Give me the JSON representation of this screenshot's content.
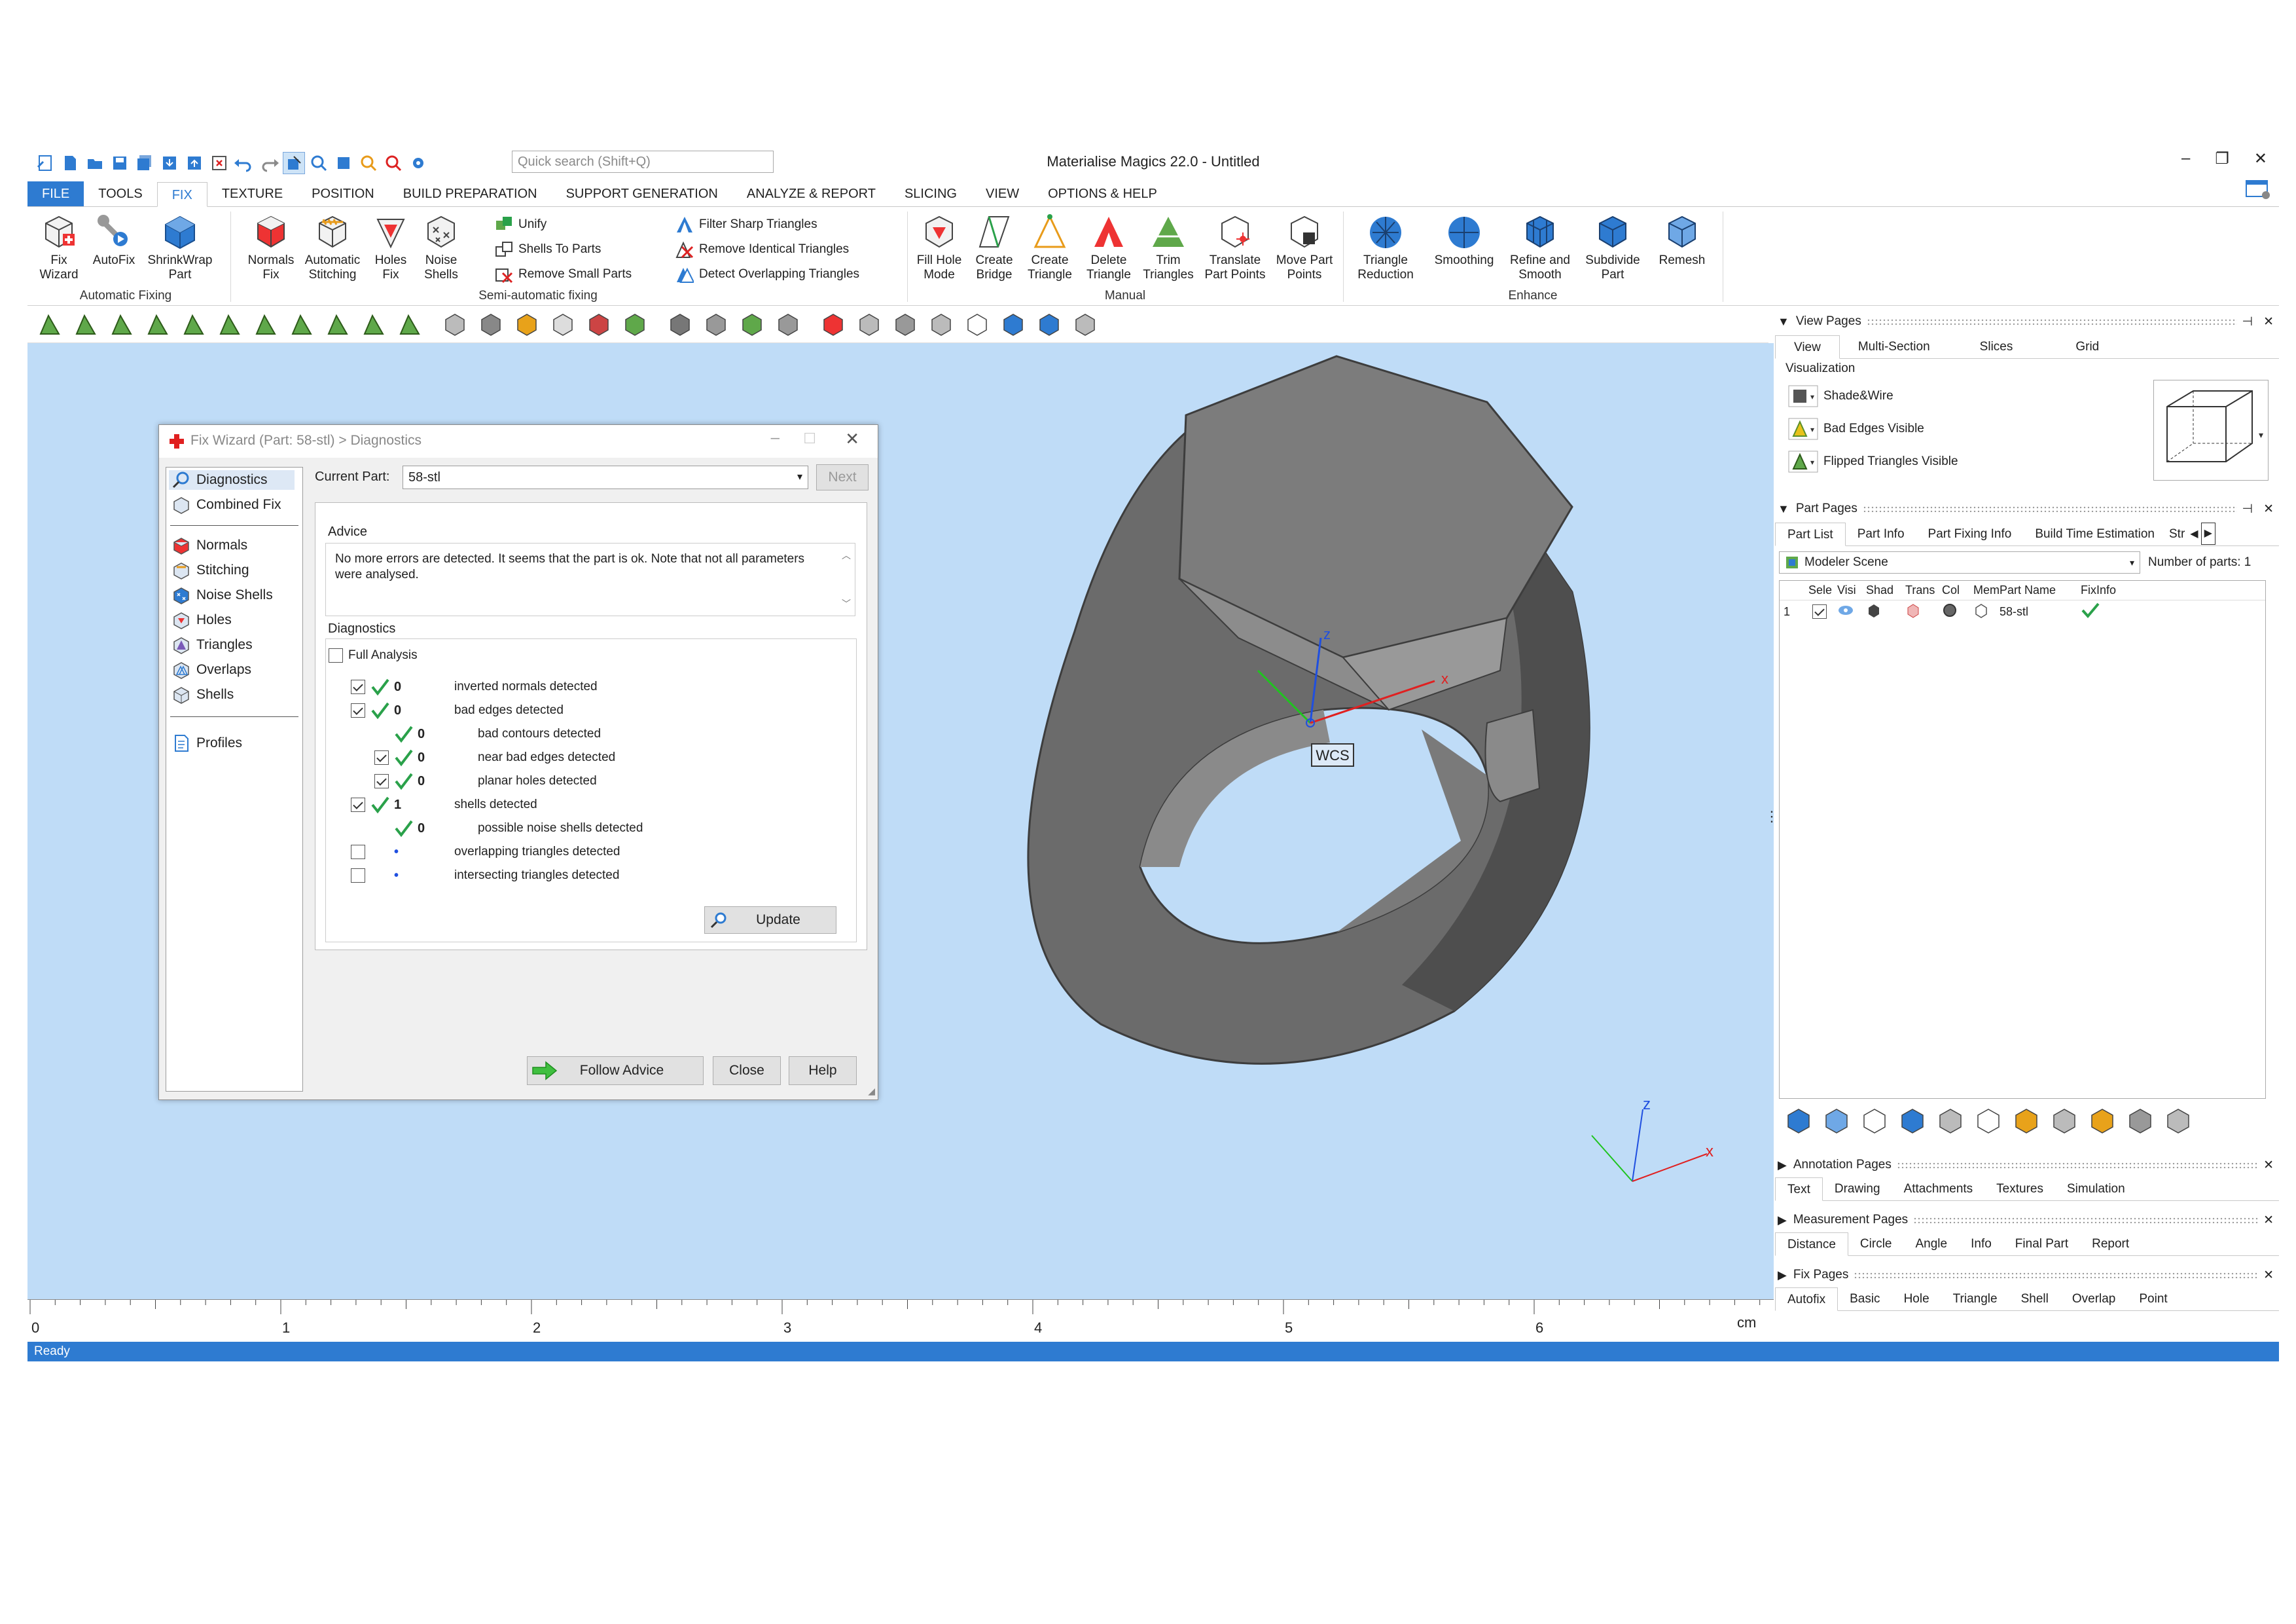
{
  "window": {
    "title": "Materialise Magics 22.0 - Untitled",
    "search_placeholder": "Quick search (Shift+Q)",
    "controls": [
      "–",
      "❐",
      "✕"
    ]
  },
  "menu_tabs": [
    "FILE",
    "TOOLS",
    "FIX",
    "TEXTURE",
    "POSITION",
    "BUILD PREPARATION",
    "SUPPORT GENERATION",
    "ANALYZE & REPORT",
    "SLICING",
    "VIEW",
    "OPTIONS & HELP"
  ],
  "active_tab": "FIX",
  "ribbon": {
    "auto": {
      "group": "Automatic Fixing",
      "fix_wizard": [
        "Fix",
        "Wizard"
      ],
      "autofix": [
        "AutoFix",
        ""
      ],
      "shrinkwrap": [
        "ShrinkWrap",
        "Part"
      ]
    },
    "semi": {
      "group": "Semi-automatic fixing",
      "normals": [
        "Normals",
        "Fix"
      ],
      "stitching": [
        "Automatic",
        "Stitching"
      ],
      "holes": [
        "Holes",
        "Fix"
      ],
      "noise": [
        "Noise",
        "Shells"
      ],
      "unify": "Unify",
      "shells_to_parts": "Shells To Parts",
      "remove_small_parts": "Remove Small Parts",
      "filter_sharp": "Filter Sharp Triangles",
      "remove_identical": "Remove Identical Triangles",
      "detect_overlapping": "Detect Overlapping Triangles"
    },
    "manual": {
      "group": "Manual",
      "fill_hole": [
        "Fill Hole",
        "Mode"
      ],
      "create_bridge": [
        "Create",
        "Bridge"
      ],
      "create_triangle": [
        "Create",
        "Triangle"
      ],
      "delete_triangle": [
        "Delete",
        "Triangle"
      ],
      "trim_triangles": [
        "Trim",
        "Triangles"
      ],
      "translate_points": [
        "Translate",
        "Part Points"
      ],
      "move_points": [
        "Move Part",
        "Points"
      ]
    },
    "enhance": {
      "group": "Enhance",
      "triangle_reduction": [
        "Triangle",
        "Reduction"
      ],
      "smoothing": [
        "Smoothing",
        ""
      ],
      "refine_smooth": [
        "Refine and",
        "Smooth"
      ],
      "subdivide": [
        "Subdivide",
        "Part"
      ],
      "remesh": [
        "Remesh",
        ""
      ]
    }
  },
  "viewport": {
    "wcs_label": "WCS",
    "axis_x": "x",
    "axis_z": "z",
    "ruler_ticks": [
      "0",
      "1",
      "2",
      "3",
      "4",
      "5",
      "6"
    ],
    "ruler_unit": "cm"
  },
  "status": "Ready",
  "dialog": {
    "title": "Fix Wizard (Part: 58-stl) > Diagnostics",
    "nav_top": [
      "Diagnostics",
      "Combined Fix"
    ],
    "nav_checks": [
      "Normals",
      "Stitching",
      "Noise Shells",
      "Holes",
      "Triangles",
      "Overlaps",
      "Shells"
    ],
    "nav_profiles": "Profiles",
    "current_part_label": "Current Part:",
    "current_part_value": "58-stl",
    "next_button": "Next",
    "advice_label": "Advice",
    "advice_text": "No more errors are detected. It seems that the part is ok. Note that not all parameters were analysed.",
    "diagnostics_label": "Diagnostics",
    "full_analysis": "Full Analysis",
    "rows": [
      {
        "count": "0",
        "label": "inverted normals detected",
        "checked": true,
        "ok": true,
        "indent": 0
      },
      {
        "count": "0",
        "label": "bad edges detected",
        "checked": true,
        "ok": true,
        "indent": 0
      },
      {
        "count": "0",
        "label": "bad contours detected",
        "checked": null,
        "ok": true,
        "indent": 1
      },
      {
        "count": "0",
        "label": "near bad edges detected",
        "checked": true,
        "ok": true,
        "indent": 1
      },
      {
        "count": "0",
        "label": "planar holes detected",
        "checked": true,
        "ok": true,
        "indent": 1
      },
      {
        "count": "1",
        "label": "shells detected",
        "checked": true,
        "ok": true,
        "indent": 0
      },
      {
        "count": "0",
        "label": "possible noise shells detected",
        "checked": null,
        "ok": true,
        "indent": 1
      },
      {
        "count": "•",
        "label": "overlapping triangles detected",
        "checked": false,
        "ok": false,
        "indent": 0
      },
      {
        "count": "•",
        "label": "intersecting triangles detected",
        "checked": false,
        "ok": false,
        "indent": 0
      }
    ],
    "update_button": "Update",
    "follow_advice_button": "Follow Advice",
    "close_button": "Close",
    "help_button": "Help"
  },
  "right_panel": {
    "view_pages": {
      "title": "View Pages",
      "tabs": [
        "View",
        "Multi-Section",
        "Slices",
        "Grid"
      ],
      "visualization_label": "Visualization",
      "items": [
        "Shade&Wire",
        "Bad Edges Visible",
        "Flipped Triangles Visible"
      ]
    },
    "part_pages": {
      "title": "Part Pages",
      "tabs": [
        "Part List",
        "Part Info",
        "Part Fixing Info",
        "Build Time Estimation",
        "Str"
      ],
      "scene": "Modeler Scene",
      "num_parts_label": "Number of parts:",
      "num_parts": "1",
      "columns": [
        "Sele",
        "Visi",
        "Shad",
        "Trans",
        "Col",
        "Mem",
        "Part Name",
        "FixInfo"
      ],
      "row": {
        "index": "1",
        "name": "58-stl"
      }
    },
    "annotation_pages": {
      "title": "Annotation Pages",
      "tabs": [
        "Text",
        "Drawing",
        "Attachments",
        "Textures",
        "Simulation"
      ]
    },
    "measurement_pages": {
      "title": "Measurement Pages",
      "tabs": [
        "Distance",
        "Circle",
        "Angle",
        "Info",
        "Final Part",
        "Report"
      ]
    },
    "fix_pages": {
      "title": "Fix Pages",
      "tabs": [
        "Autofix",
        "Basic",
        "Hole",
        "Triangle",
        "Shell",
        "Overlap",
        "Point"
      ]
    }
  },
  "colors": {
    "accent": "#2e7bd1",
    "viewport_bg": "#bfdcf7",
    "check_green": "#2aa14a",
    "model_gray": "#6b6b6b"
  }
}
